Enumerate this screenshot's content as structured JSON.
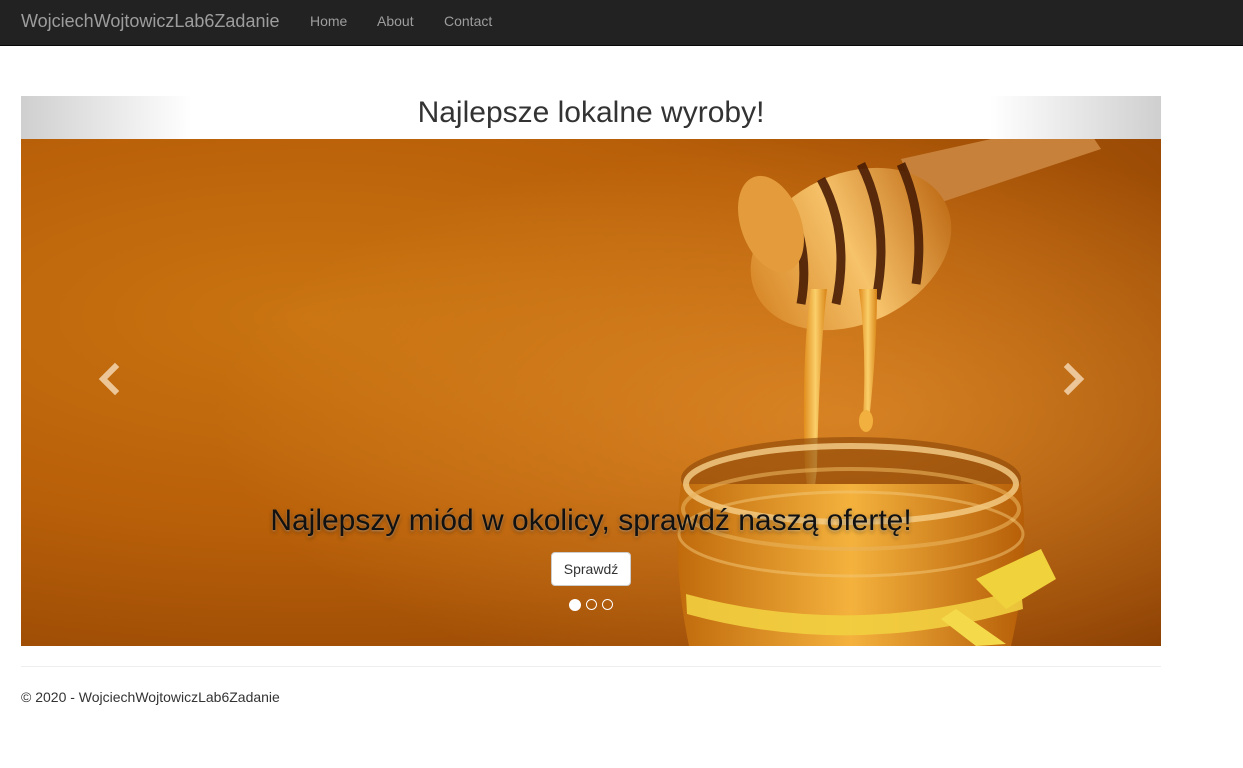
{
  "navbar": {
    "brand": "WojciechWojtowiczLab6Zadanie",
    "links": [
      {
        "label": "Home"
      },
      {
        "label": "About"
      },
      {
        "label": "Contact"
      }
    ]
  },
  "carousel": {
    "title": "Najlepsze lokalne wyroby!",
    "active_slide": 1,
    "slide_count": 3,
    "slide": {
      "image_subject": "honey dipper dripping honey into a jar",
      "caption": "Najlepszy miód w okolicy, sprawdź naszą ofertę!",
      "button_label": "Sprawdź"
    },
    "controls": {
      "prev_icon": "chevron-left-icon",
      "next_icon": "chevron-right-icon"
    }
  },
  "footer": {
    "text": "© 2020 - WojciechWojtowiczLab6Zadanie"
  },
  "colors": {
    "navbar_bg": "#222222",
    "nav_text": "#9d9d9d",
    "honey": "#c97411"
  }
}
